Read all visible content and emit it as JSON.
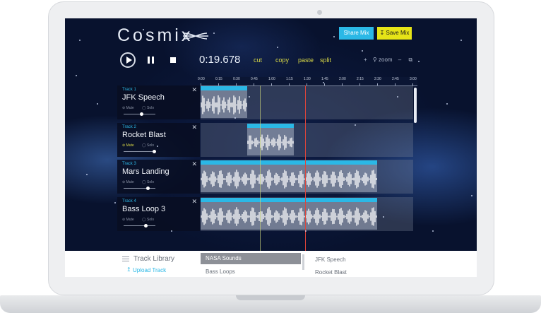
{
  "app": {
    "name": "Cosmix"
  },
  "header": {
    "share_label": "Share Mix",
    "save_label": "Save Mix"
  },
  "transport": {
    "time": "0:19.678",
    "edit_actions": [
      "cut",
      "copy",
      "paste",
      "split"
    ],
    "zoom_label": "zoom"
  },
  "timeline": {
    "ticks": [
      "0:00",
      "0:15",
      "0:30",
      "0:45",
      "1:00",
      "1:15",
      "1:30",
      "1:45",
      "2:00",
      "2:15",
      "2:30",
      "2:45",
      "3:00"
    ]
  },
  "tracks": [
    {
      "number": "Track 1",
      "name": "JFK Speech",
      "mute": "Mute",
      "solo": "Solo",
      "muted": false,
      "volume": 0.55
    },
    {
      "number": "Track 2",
      "name": "Rocket Blast",
      "mute": "Mute",
      "solo": "Solo",
      "muted": true,
      "volume": 0.95
    },
    {
      "number": "Track 3",
      "name": "Mars Landing",
      "mute": "Mute",
      "solo": "Solo",
      "muted": false,
      "volume": 0.75
    },
    {
      "number": "Track 4",
      "name": "Bass Loop 3",
      "mute": "Mute",
      "solo": "Solo",
      "muted": false,
      "volume": 0.7
    }
  ],
  "library": {
    "title": "Track Library",
    "upload_label": "Upload Track",
    "categories": [
      "NASA Sounds",
      "Bass Loops"
    ],
    "selected_category": "NASA Sounds",
    "tracks": [
      "JFK Speech",
      "Rocket Blast"
    ]
  },
  "colors": {
    "accent_blue": "#2bb8e6",
    "accent_yellow": "#e6e417"
  },
  "icons": {
    "play": "play-icon",
    "pause": "pause-icon",
    "stop": "stop-icon",
    "close": "close-icon",
    "mute": "mute-icon",
    "solo": "solo-icon",
    "zoom_in": "plus-icon",
    "zoom_search": "search-icon",
    "zoom_out": "minus-icon",
    "fit": "fit-icon",
    "library": "menu-icon",
    "upload": "upload-icon",
    "save": "download-icon"
  }
}
